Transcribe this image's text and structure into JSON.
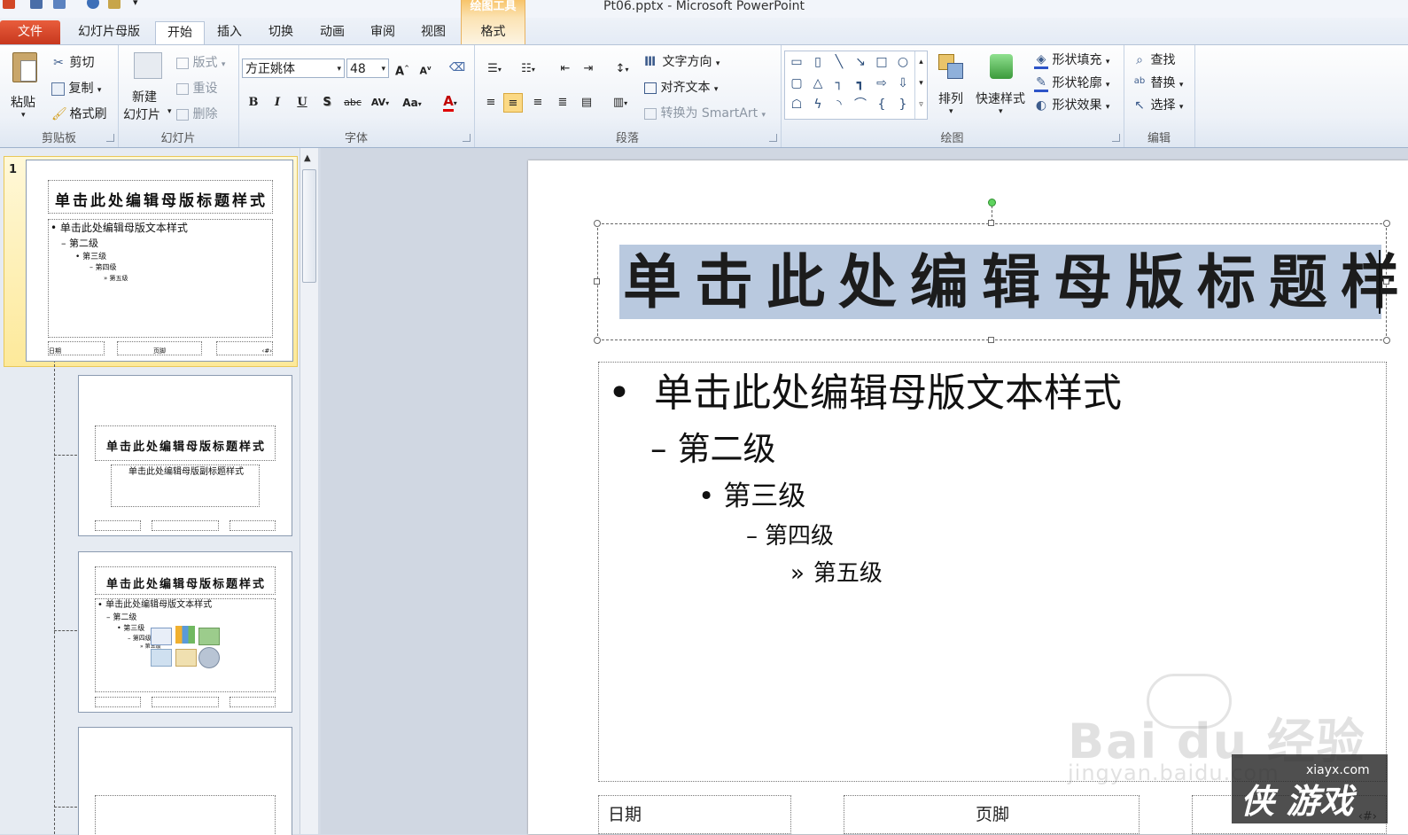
{
  "window": {
    "title": "Pt06.pptx - Microsoft PowerPoint"
  },
  "tabs": {
    "file": "文件",
    "items": [
      "幻灯片母版",
      "开始",
      "插入",
      "切换",
      "动画",
      "审阅",
      "视图"
    ],
    "contextual_group": "绘图工具",
    "contextual_tab": "格式"
  },
  "ribbon": {
    "clipboard": {
      "label": "剪贴板",
      "paste": "粘贴",
      "cut": "剪切",
      "copy": "复制",
      "format_painter": "格式刷"
    },
    "slides": {
      "label": "幻灯片",
      "new_slide_1": "新建",
      "new_slide_2": "幻灯片",
      "layout": "版式",
      "reset": "重设",
      "delete": "删除"
    },
    "font": {
      "label": "字体",
      "font_name": "方正姚体",
      "font_size": "48",
      "bold": "B",
      "italic": "I",
      "underline": "U",
      "shadow": "S",
      "strike": "abc",
      "spacing": "AV",
      "case": "Aa",
      "color": "A",
      "grow": "A",
      "shrink": "A"
    },
    "paragraph": {
      "label": "段落",
      "text_direction": "文字方向",
      "align_text": "对齐文本",
      "convert_smartart": "转换为 SmartArt"
    },
    "drawing": {
      "label": "绘图",
      "arrange": "排列",
      "quick_styles": "快速样式",
      "shape_fill": "形状填充",
      "shape_outline": "形状轮廓",
      "shape_effects": "形状效果"
    },
    "editing": {
      "label": "编辑",
      "find": "查找",
      "replace": "替换",
      "select": "选择"
    }
  },
  "thumbnails": {
    "first_number": "1",
    "master": {
      "title": "单击此处编辑母版标题样式",
      "levels": [
        "单击此处编辑母版文本样式",
        "第二级",
        "第三级",
        "第四级",
        "第五级"
      ],
      "footers": [
        "日期",
        "页脚",
        "‹#›"
      ]
    },
    "layout_title": {
      "title": "单击此处编辑母版标题样式",
      "subtitle": "单击此处编辑母版副标题样式"
    },
    "layout_content": {
      "title": "单击此处编辑母版标题样式",
      "levels": [
        "单击此处编辑母版文本样式",
        "第二级",
        "第三级",
        "第四级",
        "第五级"
      ]
    }
  },
  "slide": {
    "title": "单击此处编辑母版标题样式",
    "levels": [
      {
        "bullet": "•",
        "text": "单击此处编辑母版文本样式"
      },
      {
        "bullet": "–",
        "text": "第二级"
      },
      {
        "bullet": "•",
        "text": "第三级"
      },
      {
        "bullet": "–",
        "text": "第四级"
      },
      {
        "bullet": "»",
        "text": "第五级"
      }
    ],
    "footer_date": "日期",
    "footer_center": "页脚",
    "footer_number": "‹#›"
  },
  "watermark": {
    "brand": "Bai du 经验",
    "url": "jingyan.baidu.com",
    "site": "xiayx.com",
    "logo": "侠 游戏"
  }
}
